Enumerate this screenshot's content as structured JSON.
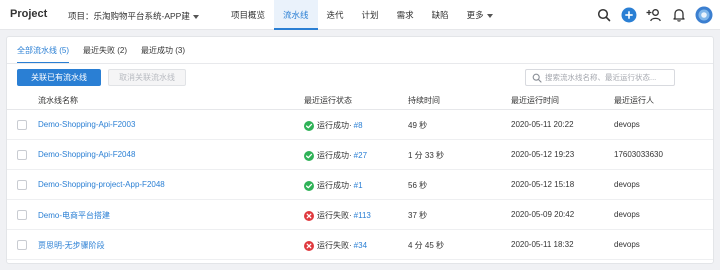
{
  "header": {
    "logo": "Project",
    "project_label": "项目：乐淘购物平台系统-APP建",
    "nav": [
      {
        "label": "项目概览",
        "active": false
      },
      {
        "label": "流水线",
        "active": true
      },
      {
        "label": "迭代",
        "active": false
      },
      {
        "label": "计划",
        "active": false
      },
      {
        "label": "需求",
        "active": false
      },
      {
        "label": "缺陷",
        "active": false
      },
      {
        "label": "更多",
        "active": false
      }
    ],
    "icons": [
      "search-icon",
      "plus-circle-icon",
      "add-user-icon",
      "bell-icon",
      "avatar"
    ]
  },
  "tabs": [
    {
      "label": "全部流水线 (5)",
      "active": true
    },
    {
      "label": "最近失败 (2)",
      "active": false
    },
    {
      "label": "最近成功 (3)",
      "active": false
    }
  ],
  "toolbar": {
    "link_button": "关联已有流水线",
    "unlink_button": "取消关联流水线",
    "search_placeholder": "搜索流水线名称、最近运行状态..."
  },
  "table": {
    "columns": [
      "流水线名称",
      "最近运行状态",
      "持续时间",
      "最近运行时间",
      "最近运行人"
    ],
    "rows": [
      {
        "name": "Demo-Shopping-Api-F2003",
        "status": "运行成功·",
        "status_type": "success",
        "run": "#8",
        "duration": "49 秒",
        "time": "2020-05-11 20:22",
        "user": "devops"
      },
      {
        "name": "Demo-Shopping-Api-F2048",
        "status": "运行成功·",
        "status_type": "success",
        "run": "#27",
        "duration": "1 分 33 秒",
        "time": "2020-05-12 19:23",
        "user": "17603033630"
      },
      {
        "name": "Demo-Shopping-project-App-F2048",
        "status": "运行成功·",
        "status_type": "success",
        "run": "#1",
        "duration": "56 秒",
        "time": "2020-05-12 15:18",
        "user": "devops"
      },
      {
        "name": "Demo-电商平台搭建",
        "status": "运行失败·",
        "status_type": "fail",
        "run": "#113",
        "duration": "37 秒",
        "time": "2020-05-09 20:42",
        "user": "devops"
      },
      {
        "name": "贾思明-无步骤阶段",
        "status": "运行失败·",
        "status_type": "fail",
        "run": "#34",
        "duration": "4 分 45 秒",
        "time": "2020-05-11 18:32",
        "user": "devops"
      }
    ]
  },
  "colors": {
    "accent": "#2a7fd4",
    "success": "#2fb257",
    "fail": "#e0393e"
  }
}
